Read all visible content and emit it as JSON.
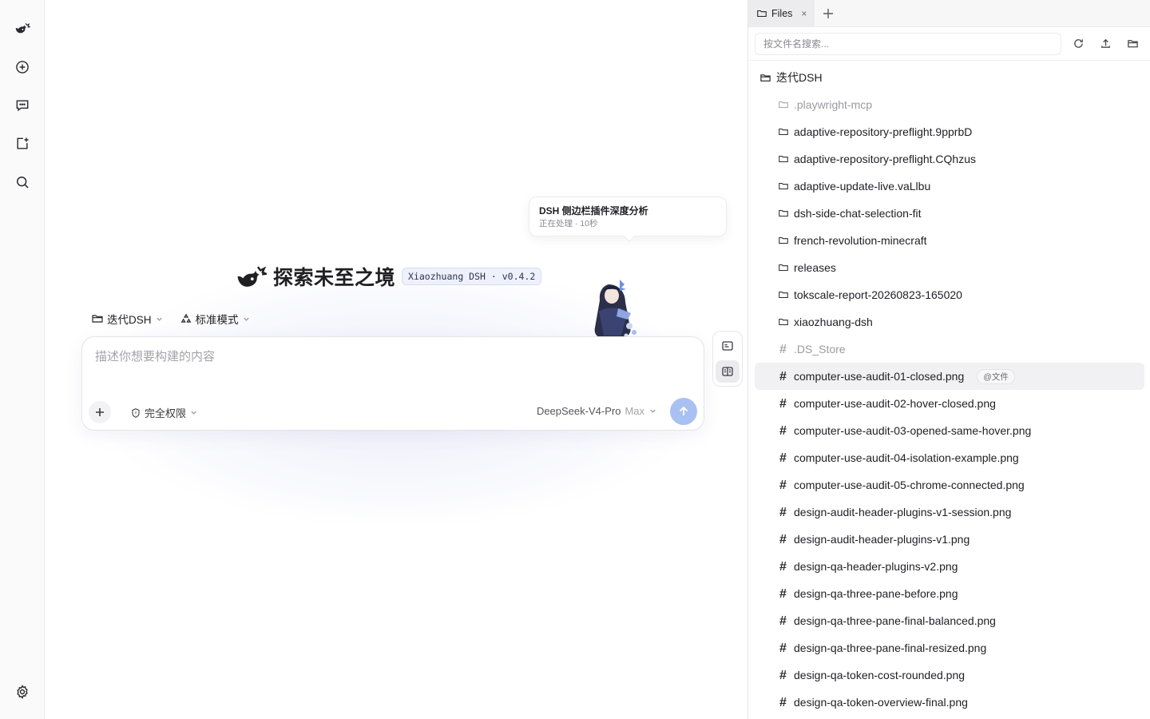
{
  "toast": {
    "title": "DSH 侧边栏插件深度分析",
    "subtitle": "正在处理 · 10秒"
  },
  "hero": {
    "title": "探索未至之境",
    "version_badge": "Xiaozhuang DSH · v0.4.2"
  },
  "options": {
    "workspace": "迭代DSH",
    "mode": "标准模式"
  },
  "composer": {
    "placeholder": "描述你想要构建的内容",
    "permission": "完全权限",
    "model": "DeepSeek-V4-Pro",
    "model_tier": "Max"
  },
  "files_panel": {
    "tab_label": "Files",
    "tab_close": "×",
    "search_placeholder": "按文件名搜索...",
    "root": "迭代DSH",
    "at_badge": "@文件",
    "items": [
      {
        "name": ".playwright-mcp",
        "kind": "folder",
        "muted": true
      },
      {
        "name": "adaptive-repository-preflight.9pprbD",
        "kind": "folder"
      },
      {
        "name": "adaptive-repository-preflight.CQhzus",
        "kind": "folder"
      },
      {
        "name": "adaptive-update-live.vaLlbu",
        "kind": "folder"
      },
      {
        "name": "dsh-side-chat-selection-fit",
        "kind": "folder"
      },
      {
        "name": "french-revolution-minecraft",
        "kind": "folder"
      },
      {
        "name": "releases",
        "kind": "folder"
      },
      {
        "name": "tokscale-report-20260823-165020",
        "kind": "folder"
      },
      {
        "name": "xiaozhuang-dsh",
        "kind": "folder"
      },
      {
        "name": ".DS_Store",
        "kind": "file",
        "muted": true
      },
      {
        "name": "computer-use-audit-01-closed.png",
        "kind": "file",
        "selected": true
      },
      {
        "name": "computer-use-audit-02-hover-closed.png",
        "kind": "file"
      },
      {
        "name": "computer-use-audit-03-opened-same-hover.png",
        "kind": "file"
      },
      {
        "name": "computer-use-audit-04-isolation-example.png",
        "kind": "file"
      },
      {
        "name": "computer-use-audit-05-chrome-connected.png",
        "kind": "file"
      },
      {
        "name": "design-audit-header-plugins-v1-session.png",
        "kind": "file"
      },
      {
        "name": "design-audit-header-plugins-v1.png",
        "kind": "file"
      },
      {
        "name": "design-qa-header-plugins-v2.png",
        "kind": "file"
      },
      {
        "name": "design-qa-three-pane-before.png",
        "kind": "file"
      },
      {
        "name": "design-qa-three-pane-final-balanced.png",
        "kind": "file"
      },
      {
        "name": "design-qa-three-pane-final-resized.png",
        "kind": "file"
      },
      {
        "name": "design-qa-token-cost-rounded.png",
        "kind": "file"
      },
      {
        "name": "design-qa-token-overview-final.png",
        "kind": "file"
      }
    ]
  },
  "icons": {
    "rail": [
      "whale-logo-icon",
      "new-chat-plus-icon",
      "chat-bubble-icon",
      "new-project-icon",
      "search-icon",
      "settings-gear-icon"
    ],
    "folder": "folder-icon",
    "file": "hash-file-icon"
  },
  "colors": {
    "accent": "#a9c0f2",
    "badge_bg": "#eef0fb",
    "selected_row": "#f1f1f3"
  }
}
